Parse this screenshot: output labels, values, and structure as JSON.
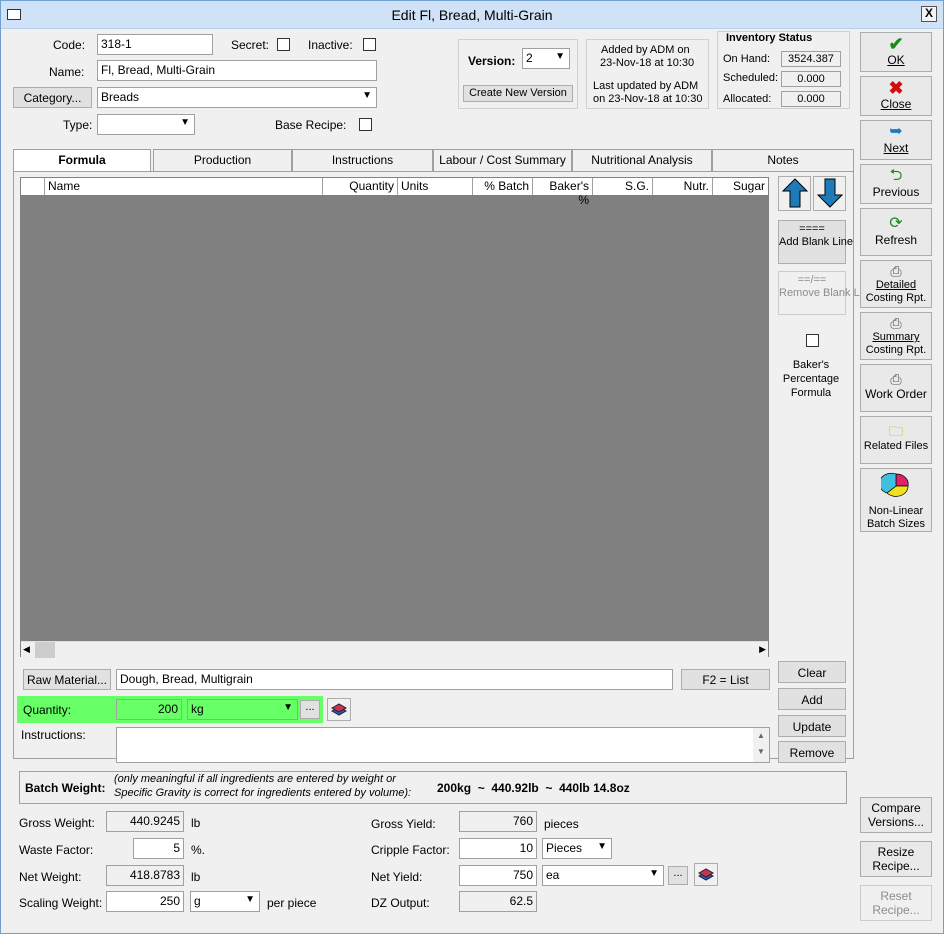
{
  "window": {
    "title": "Edit Fl, Bread, Multi-Grain",
    "close": "X"
  },
  "header": {
    "code_label": "Code:",
    "code_value": "318-1",
    "secret_label": "Secret:",
    "inactive_label": "Inactive:",
    "name_label": "Name:",
    "name_value": "Fl, Bread, Multi-Grain",
    "category_button": "Category...",
    "category_value": "Breads",
    "type_label": "Type:",
    "type_value": "",
    "base_recipe_label": "Base Recipe:"
  },
  "version": {
    "label": "Version:",
    "value": "2",
    "create_button": "Create New Version"
  },
  "audit": {
    "added_line1": "Added by ADM on",
    "added_line2": "23-Nov-18 at 10:30",
    "updated_line1": "Last updated by ADM",
    "updated_line2": "on 23-Nov-18 at 10:30"
  },
  "inventory": {
    "title": "Inventory Status",
    "on_hand_label": "On Hand:",
    "on_hand": "3524.387",
    "scheduled_label": "Scheduled:",
    "scheduled": "0.000",
    "allocated_label": "Allocated:",
    "allocated": "0.000"
  },
  "tabs": [
    "Formula",
    "Production",
    "Instructions",
    "Labour / Cost Summary",
    "Nutritional Analysis",
    "Notes"
  ],
  "grid": {
    "columns": [
      "Name",
      "Quantity",
      "Units",
      "% Batch",
      "Baker's %",
      "S.G.",
      "Nutr.",
      "Sugar"
    ]
  },
  "grid_side": {
    "add_blank_icon": "====",
    "add_blank": "Add Blank Line",
    "remove_blank_icon": "==/==",
    "remove_blank": "Remove Blank Line",
    "bakers_pct": "Baker's Percentage Formula"
  },
  "entry": {
    "raw_material_button": "Raw Material...",
    "raw_material_value": "Dough, Bread, Multigrain",
    "f2_button": "F2 = List",
    "quantity_label": "Quantity:",
    "quantity_value": "200",
    "unit_value": "kg",
    "ellipsis": "...",
    "instructions_label": "Instructions:",
    "clear": "Clear",
    "add": "Add",
    "update": "Update",
    "remove": "Remove"
  },
  "batch": {
    "label": "Batch Weight:",
    "note1": "(only meaningful if all ingredients are entered by weight or",
    "note2": "Specific Gravity is correct for ingredients entered by volume):",
    "value": "200kg  ~  440.92lb  ~  440lb 14.8oz"
  },
  "weights": {
    "gross_label": "Gross Weight:",
    "gross": "440.9245",
    "gross_unit": "lb",
    "waste_label": "Waste Factor:",
    "waste": "5",
    "waste_unit": "%.",
    "net_label": "Net Weight:",
    "net": "418.8783",
    "net_unit": "lb",
    "scaling_label": "Scaling Weight:",
    "scaling": "250",
    "scaling_unit": "g",
    "per_piece": "per piece"
  },
  "yields": {
    "gross_label": "Gross Yield:",
    "gross": "760",
    "gross_unit": "pieces",
    "cripple_label": "Cripple Factor:",
    "cripple": "10",
    "cripple_unit": "Pieces",
    "net_label": "Net Yield:",
    "net": "750",
    "net_unit": "ea",
    "ellipsis": "...",
    "dz_label": "DZ Output:",
    "dz": "62.5"
  },
  "sidebar": {
    "ok": "OK",
    "close": "Close",
    "next": "Next",
    "previous": "Previous",
    "refresh": "Refresh",
    "detailed1": "Detailed",
    "detailed2": "Costing Rpt.",
    "summary1": "Summary",
    "summary2": "Costing Rpt.",
    "work_order": "Work Order",
    "related_files": "Related Files",
    "nonlinear1": "Non-Linear",
    "nonlinear2": "Batch Sizes",
    "compare1": "Compare",
    "compare2": "Versions...",
    "resize1": "Resize",
    "resize2": "Recipe...",
    "reset1": "Reset",
    "reset2": "Recipe..."
  },
  "colors": {
    "highlight": "#66ff66",
    "grid_bg": "#808080",
    "title_bg": "#cfe2f7"
  }
}
